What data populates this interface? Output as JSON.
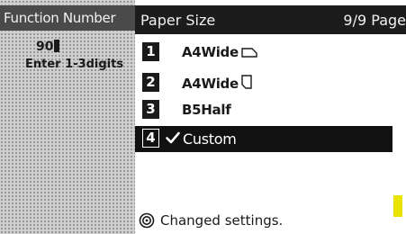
{
  "left": {
    "header": "Function Number",
    "value": "90",
    "hint": "Enter 1-3digits"
  },
  "right": {
    "title": "Paper Size",
    "page": "9/9 Page",
    "items": [
      {
        "num": "1",
        "label": "A4Wide",
        "icon": "landscape-page-icon"
      },
      {
        "num": "2",
        "label": "A4Wide",
        "icon": "portrait-page-icon"
      },
      {
        "num": "3",
        "label": "B5Half",
        "icon": ""
      },
      {
        "num": "4",
        "label": "Custom",
        "icon": "checkmark-icon",
        "selected": true
      }
    ],
    "status": "Changed settings.",
    "status_icon": "changed-settings-icon"
  },
  "scrollbar": {
    "position": 0.91,
    "thumb_fraction": 0.11,
    "color": "#e8e400"
  },
  "colors": {
    "header_left": "#4a4a4a",
    "header_right": "#1c1c1c",
    "selected_bg": "#111111"
  }
}
